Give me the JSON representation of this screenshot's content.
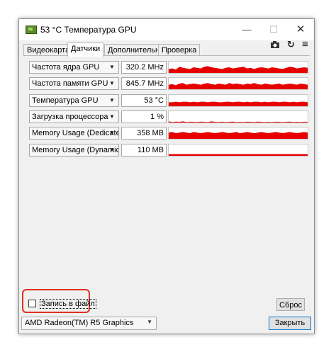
{
  "window": {
    "title": "53 °C Температура GPU",
    "minimize_glyph": "—",
    "maximize_glyph": "☐",
    "close_glyph": "✕"
  },
  "tabs": [
    "Видеокарта",
    "Датчики",
    "Дополнительно",
    "Проверка"
  ],
  "toolbar": {
    "camera_icon": "camera-icon",
    "refresh_icon": "refresh-icon",
    "menu_icon": "hamburger-icon"
  },
  "sensors": [
    {
      "name": "Частота ядра GPU",
      "value": "320.2 MHz",
      "series": [
        0.35,
        0.4,
        0.3,
        0.55,
        0.45,
        0.4,
        0.35,
        0.5,
        0.45,
        0.4,
        0.55,
        0.6,
        0.5,
        0.45,
        0.4,
        0.35,
        0.45,
        0.5,
        0.4,
        0.45,
        0.5,
        0.55,
        0.4,
        0.45,
        0.35,
        0.45,
        0.5,
        0.45,
        0.4,
        0.5,
        0.45,
        0.4,
        0.35,
        0.45,
        0.55,
        0.5,
        0.4,
        0.45,
        0.5,
        0.45
      ]
    },
    {
      "name": "Частота памяти GPU",
      "value": "845.7 MHz",
      "series": [
        0.4,
        0.45,
        0.35,
        0.5,
        0.55,
        0.4,
        0.45,
        0.5,
        0.45,
        0.4,
        0.5,
        0.55,
        0.45,
        0.4,
        0.5,
        0.45,
        0.4,
        0.55,
        0.45,
        0.5,
        0.45,
        0.4,
        0.5,
        0.45,
        0.55,
        0.45,
        0.4,
        0.5,
        0.45,
        0.4,
        0.45,
        0.5,
        0.4,
        0.45,
        0.5,
        0.45,
        0.4,
        0.5,
        0.45,
        0.4
      ]
    },
    {
      "name": "Температура GPU",
      "value": "53 °C",
      "series": [
        0.35,
        0.35,
        0.4,
        0.35,
        0.4,
        0.4,
        0.35,
        0.4,
        0.35,
        0.4,
        0.4,
        0.35,
        0.4,
        0.4,
        0.35,
        0.35,
        0.4,
        0.4,
        0.35,
        0.4,
        0.4,
        0.35,
        0.4,
        0.35,
        0.4,
        0.4,
        0.35,
        0.4,
        0.35,
        0.4,
        0.4,
        0.35,
        0.4,
        0.4,
        0.35,
        0.4,
        0.35,
        0.4,
        0.4,
        0.35
      ]
    },
    {
      "name": "Загрузка процессора",
      "value": "1 %",
      "series": [
        0.1,
        0.05,
        0.08,
        0.06,
        0.1,
        0.05,
        0.07,
        0.06,
        0.05,
        0.08,
        0.06,
        0.05,
        0.1,
        0.06,
        0.05,
        0.07,
        0.05,
        0.06,
        0.08,
        0.05,
        0.06,
        0.05,
        0.07,
        0.06,
        0.05,
        0.08,
        0.06,
        0.05,
        0.06,
        0.05,
        0.07,
        0.06,
        0.05,
        0.06,
        0.08,
        0.05,
        0.06,
        0.05,
        0.07,
        0.06
      ]
    },
    {
      "name": "Memory Usage (Dedicated)",
      "value": "358 MB",
      "series": [
        0.55,
        0.6,
        0.5,
        0.55,
        0.6,
        0.55,
        0.5,
        0.6,
        0.55,
        0.5,
        0.55,
        0.6,
        0.55,
        0.5,
        0.55,
        0.6,
        0.55,
        0.5,
        0.55,
        0.6,
        0.5,
        0.55,
        0.6,
        0.55,
        0.5,
        0.55,
        0.6,
        0.55,
        0.5,
        0.55,
        0.6,
        0.55,
        0.5,
        0.55,
        0.6,
        0.55,
        0.5,
        0.55,
        0.6,
        0.55
      ]
    },
    {
      "name": "Memory Usage (Dynamic)",
      "value": "110 MB",
      "series": [
        0.15,
        0.15,
        0.15,
        0.15,
        0.15,
        0.15,
        0.15,
        0.15,
        0.15,
        0.15,
        0.15,
        0.15,
        0.15,
        0.15,
        0.15,
        0.15,
        0.15,
        0.15,
        0.15,
        0.15,
        0.15,
        0.15,
        0.15,
        0.15,
        0.15,
        0.15,
        0.15,
        0.15,
        0.15,
        0.15,
        0.15,
        0.15,
        0.15,
        0.15,
        0.15,
        0.15,
        0.15,
        0.15,
        0.15,
        0.15
      ]
    }
  ],
  "graph_color": "#e60000",
  "highlight_color": "#e0301e",
  "log_to_file": {
    "label": "Запись в файл",
    "checked": false
  },
  "reset_button": "Сброс",
  "gpu_selector": {
    "selected": "AMD Radeon(TM) R5 Graphics"
  },
  "close_button": "Закрыть"
}
